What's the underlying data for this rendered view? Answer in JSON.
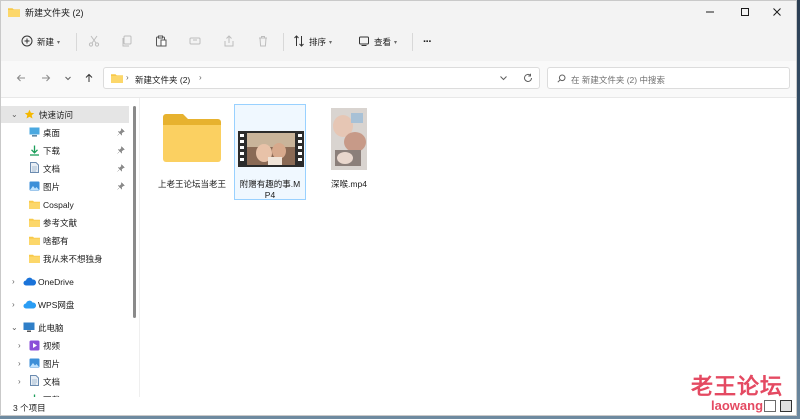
{
  "window": {
    "title": "新建文件夹 (2)"
  },
  "toolbar": {
    "new_label": "新建",
    "sort_label": "排序",
    "view_label": "查看",
    "more_label": "···"
  },
  "address": {
    "crumb": "新建文件夹 (2)",
    "search_placeholder": "在 新建文件夹 (2) 中搜索"
  },
  "sidebar": {
    "quick_access": "快速访问",
    "items": [
      {
        "label": "桌面",
        "icon": "desktop-icon",
        "pinned": true
      },
      {
        "label": "下载",
        "icon": "download-icon",
        "pinned": true
      },
      {
        "label": "文档",
        "icon": "document-icon",
        "pinned": true
      },
      {
        "label": "图片",
        "icon": "picture-icon",
        "pinned": true
      },
      {
        "label": "Cospaly",
        "icon": "folder-icon",
        "pinned": false
      },
      {
        "label": "参考文献",
        "icon": "folder-icon",
        "pinned": false
      },
      {
        "label": "啥都有",
        "icon": "folder-icon",
        "pinned": false
      },
      {
        "label": "我从来不想独身",
        "icon": "folder-icon",
        "pinned": false
      }
    ],
    "onedrive": "OneDrive",
    "wps": "WPS网盘",
    "this_pc": "此电脑",
    "pc_items": [
      {
        "label": "视频",
        "icon": "video-icon"
      },
      {
        "label": "图片",
        "icon": "picture-icon"
      },
      {
        "label": "文档",
        "icon": "document-icon"
      },
      {
        "label": "下载",
        "icon": "download-icon"
      }
    ]
  },
  "files": [
    {
      "name": "上老王论坛当老王",
      "type": "folder"
    },
    {
      "name": "附赠有趣的事.MP4",
      "type": "video",
      "selected": true
    },
    {
      "name": "深喉.mp4",
      "type": "video-portrait"
    }
  ],
  "status": {
    "count": "3 个项目"
  },
  "watermark": {
    "title": "老王论坛",
    "domain": "laowang"
  },
  "colors": {
    "folder": "#f8c949",
    "accent": "#0067c0",
    "selection_border": "#99d1ff",
    "watermark": "#e02b47"
  }
}
